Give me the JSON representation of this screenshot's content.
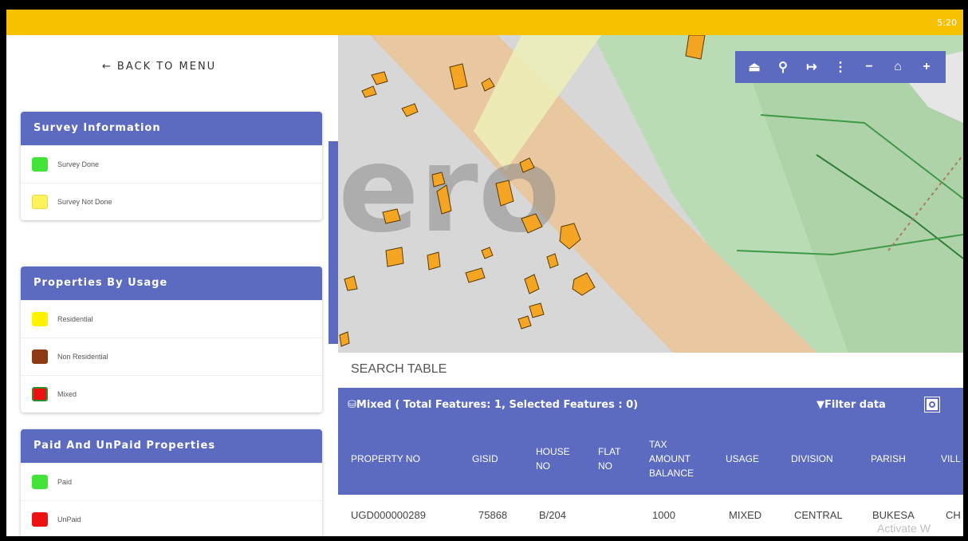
{
  "status": {
    "time": "5:20"
  },
  "nav": {
    "back_label": "BACK TO MENU"
  },
  "legend": [
    {
      "title": "Survey Information",
      "items": [
        {
          "label": "Survey Done",
          "color": "#44e33a"
        },
        {
          "label": "Survey Not Done",
          "color": "#fff25a"
        }
      ]
    },
    {
      "title": "Properties By Usage",
      "items": [
        {
          "label": "Residential",
          "color": "#fff200"
        },
        {
          "label": "Non Residential",
          "color": "#8b3a14"
        },
        {
          "label": "Mixed",
          "color": "#ee1111"
        }
      ]
    },
    {
      "title": "Paid And UnPaid Properties",
      "items": [
        {
          "label": "Paid",
          "color": "#44e33a"
        },
        {
          "label": "UnPaid",
          "color": "#ee1111"
        }
      ]
    }
  ],
  "map": {
    "toolbar": [
      {
        "name": "upload-icon",
        "glyph": "⏏"
      },
      {
        "name": "zoom-icon",
        "glyph": "⚲"
      },
      {
        "name": "sign-out-icon",
        "glyph": "↦"
      },
      {
        "name": "more-icon",
        "glyph": "⋮"
      },
      {
        "name": "zoom-out-icon",
        "glyph": "−"
      },
      {
        "name": "home-icon",
        "glyph": "⌂"
      },
      {
        "name": "zoom-in-icon",
        "glyph": "+"
      }
    ],
    "colors": {
      "building": "#f5a524",
      "road": "#e9c7a0",
      "park": "#b9dcb4"
    }
  },
  "table": {
    "search_title": "SEARCH TABLE",
    "caption": "Mixed ( Total Features: 1, Selected Features : 0)",
    "filter_label": "Filter data",
    "columns": [
      "PROPERTY NO",
      "GISID",
      "HOUSE NO",
      "FLAT NO",
      "TAX AMOUNT BALANCE",
      "USAGE",
      "DIVISION",
      "PARISH",
      "VILL"
    ],
    "rows": [
      [
        "UGD000000289",
        "75868",
        "B/204",
        "",
        "1000",
        "MIXED",
        "CENTRAL",
        "BUKESA",
        "CH"
      ]
    ]
  },
  "watermark": "Activate W"
}
